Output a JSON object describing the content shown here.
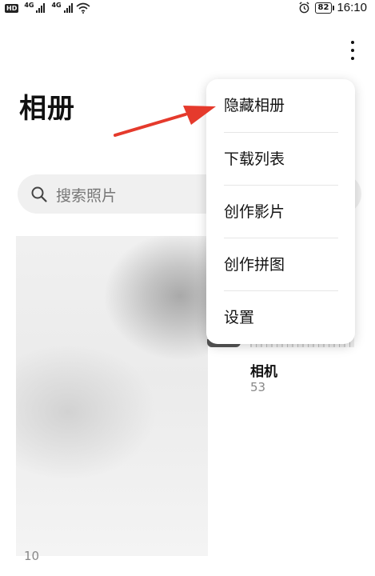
{
  "status_bar": {
    "hd_label": "HD",
    "net1": "4G",
    "net2": "4G",
    "battery": "82",
    "time": "16:10"
  },
  "header": {
    "title": "相册",
    "more_icon": "more-vertical-icon"
  },
  "search": {
    "placeholder": "搜索照片",
    "icon": "search-icon"
  },
  "albums": [
    {
      "count_partial": "10"
    },
    {
      "name": "相机",
      "count": "53"
    }
  ],
  "menu": {
    "items": [
      {
        "label": "隐藏相册"
      },
      {
        "label": "下载列表"
      },
      {
        "label": "创作影片"
      },
      {
        "label": "创作拼图"
      },
      {
        "label": "设置"
      }
    ]
  },
  "annotation": {
    "arrow_color": "#e53a2c"
  }
}
